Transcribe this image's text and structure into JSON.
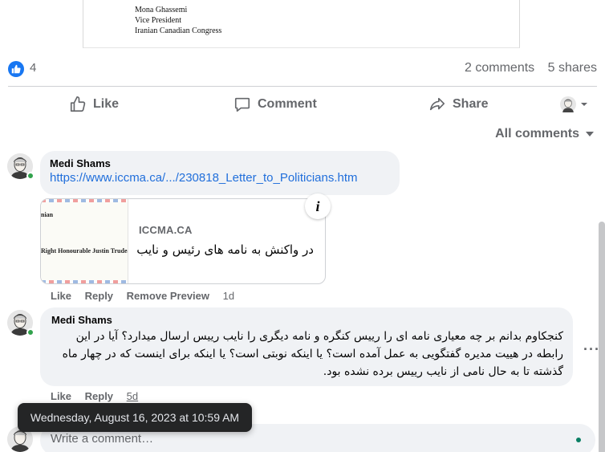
{
  "letter": {
    "name": "Mona Ghassemi",
    "role": "Vice President",
    "org": "Iranian Canadian Congress"
  },
  "reactions": {
    "like_count": "4",
    "comments": "2 comments",
    "shares": "5 shares"
  },
  "actions": {
    "like": "Like",
    "comment": "Comment",
    "share": "Share"
  },
  "filter": {
    "label": "All comments"
  },
  "comments": [
    {
      "author": "Medi Shams",
      "link": "https://www.iccma.ca/.../230818_Letter_to_Politicians.htm",
      "preview": {
        "thumb_line1": "nian",
        "thumb_line2": "Right Honourable Justin Trudeau, P.",
        "domain": "ICCMA.CA",
        "title": "در واکنش به نامه های رئیس و نایب"
      },
      "like": "Like",
      "reply": "Reply",
      "remove": "Remove Preview",
      "time": "1d"
    },
    {
      "author": "Medi Shams",
      "text": "کنجکاوم بدانم بر چه معیاری نامه ای را رییس کنگره و نامه دیگری را نایب رییس ارسال میدارد؟ آیا در این رابطه در هییت مدیره گفتگویی به عمل آمده است؟ یا اینکه نوبتی است؟ یا اینکه برای اینست که در چهار ماه گذشته تا به حال نامی از نایب رییس برده نشده بود.",
      "like": "Like",
      "reply": "Reply",
      "time": "5d"
    }
  ],
  "tooltip": "Wednesday, August 16, 2023 at 10:59 AM",
  "composer": {
    "placeholder": "Write a comment…"
  },
  "colors": {
    "accent": "#1877f2",
    "link": "#216fdb",
    "muted": "#65676b",
    "bubble": "#f0f2f5",
    "online": "#31a24c"
  }
}
